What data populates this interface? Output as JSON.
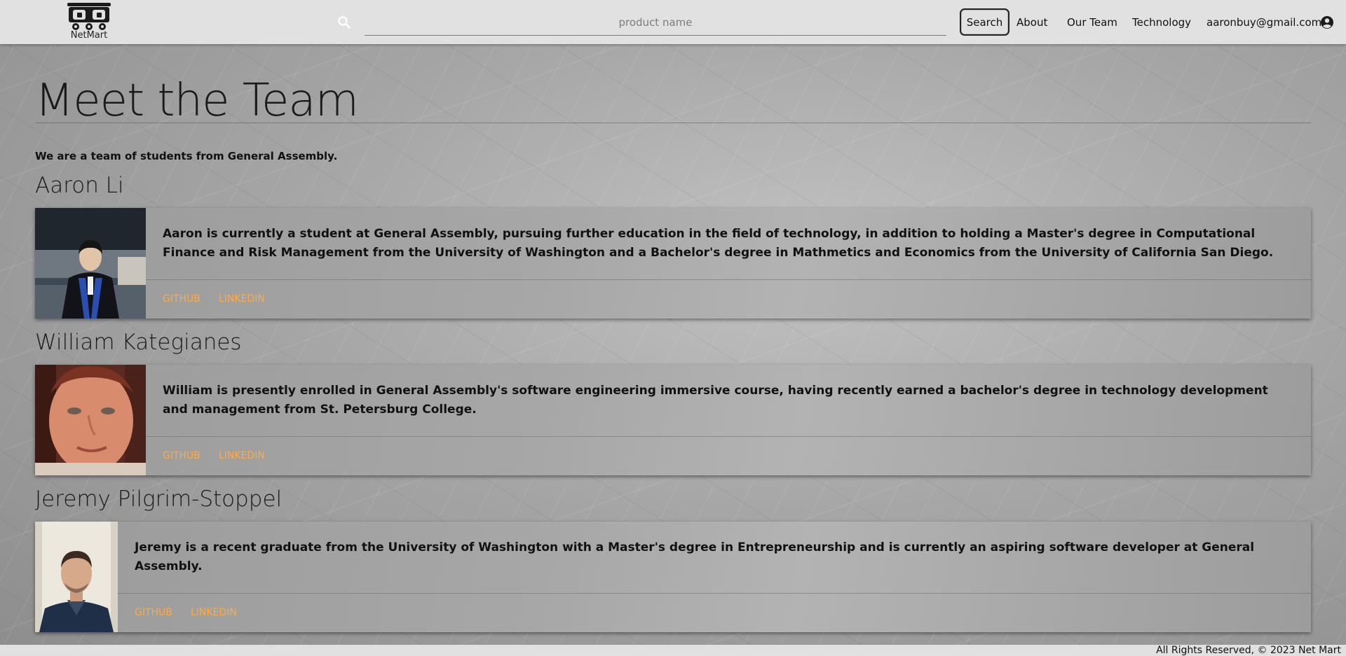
{
  "header": {
    "logo_text": "NetMart",
    "search_placeholder": "product name",
    "search_button": "Search",
    "nav": {
      "about": "About",
      "our_team": "Our Team",
      "technology": "Technology",
      "user_email": "aaronbuy@gmail.com"
    }
  },
  "main": {
    "title": "Meet the Team",
    "intro": "We are a team of students from General Assembly.",
    "members": [
      {
        "name": "Aaron Li",
        "bio": "Aaron is currently a student at General Assembly, pursuing further education in the field of technology, in addition to holding a Master's degree in Computational Finance and Risk Management from the University of Washington and a Bachelor's degree in Mathmetics and Economics from the University of California San Diego.",
        "github": "GITHUB",
        "linkedin": "LINKEDIN"
      },
      {
        "name": "William Kategianes",
        "bio": "William is presently enrolled in General Assembly's software engineering immersive course, having recently earned a bachelor's degree in technology development and management from St. Petersburg College.",
        "github": "GITHUB",
        "linkedin": "LINKEDIN"
      },
      {
        "name": "Jeremy Pilgrim-Stoppel",
        "bio": "Jeremy is a recent graduate from the University of Washington with a Master's degree in Entrepreneurship and is currently an aspiring software developer at General Assembly.",
        "github": "GITHUB",
        "linkedin": "LINKEDIN"
      }
    ]
  },
  "footer": {
    "text": "All Rights Reserved, © 2023 Net Mart"
  },
  "icons": {
    "logo": "robot-cart-logo-icon",
    "search": "search-icon",
    "user": "account-circle-icon"
  },
  "colors": {
    "navbar_bg": "#e1e1e1",
    "link_accent": "#ffab40",
    "card_bg": "#a7a7a7"
  }
}
